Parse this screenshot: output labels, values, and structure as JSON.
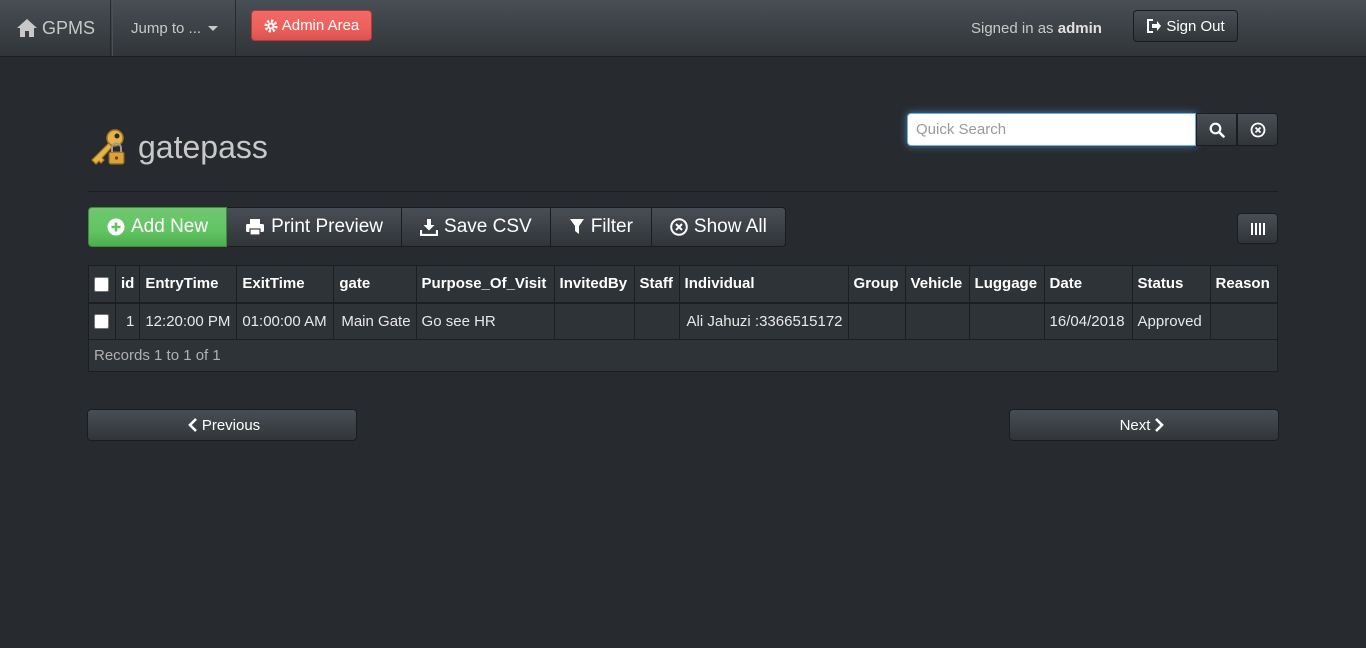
{
  "navbar": {
    "brand": "GPMS",
    "jump_label": "Jump to ...",
    "admin_label": "Admin Area",
    "signed_prefix": "Signed in as",
    "signed_user": "admin",
    "signout_label": "Sign Out"
  },
  "page": {
    "title": "gatepass"
  },
  "search": {
    "placeholder": "Quick Search"
  },
  "toolbar": {
    "add_new": "Add New",
    "print_preview": "Print Preview",
    "save_csv": "Save CSV",
    "filter": "Filter",
    "show_all": "Show All"
  },
  "table": {
    "headers": [
      "id",
      "EntryTime",
      "ExitTime",
      "gate",
      "Purpose_Of_Visit",
      "InvitedBy",
      "Staff",
      "Individual",
      "Group",
      "Vehicle",
      "Luggage",
      "Date",
      "Status",
      "Reason"
    ],
    "rows": [
      {
        "id": "1",
        "entry_time": "12:20:00 PM",
        "exit_time": "01:00:00 AM",
        "gate": "Main Gate",
        "purpose": "Go see HR",
        "invited_by": "",
        "staff": "",
        "individual": "Ali Jahuzi :3366515172",
        "group": "",
        "vehicle": "",
        "luggage": "",
        "date": "16/04/2018",
        "status": "Approved",
        "reason": ""
      }
    ],
    "records_text": "Records 1 to 1 of 1"
  },
  "pagination": {
    "previous": "Previous",
    "next": "Next"
  },
  "colors": {
    "background": "#272b30",
    "success": "#62c462",
    "danger": "#ee5f5b",
    "focus": "#66afe9"
  }
}
